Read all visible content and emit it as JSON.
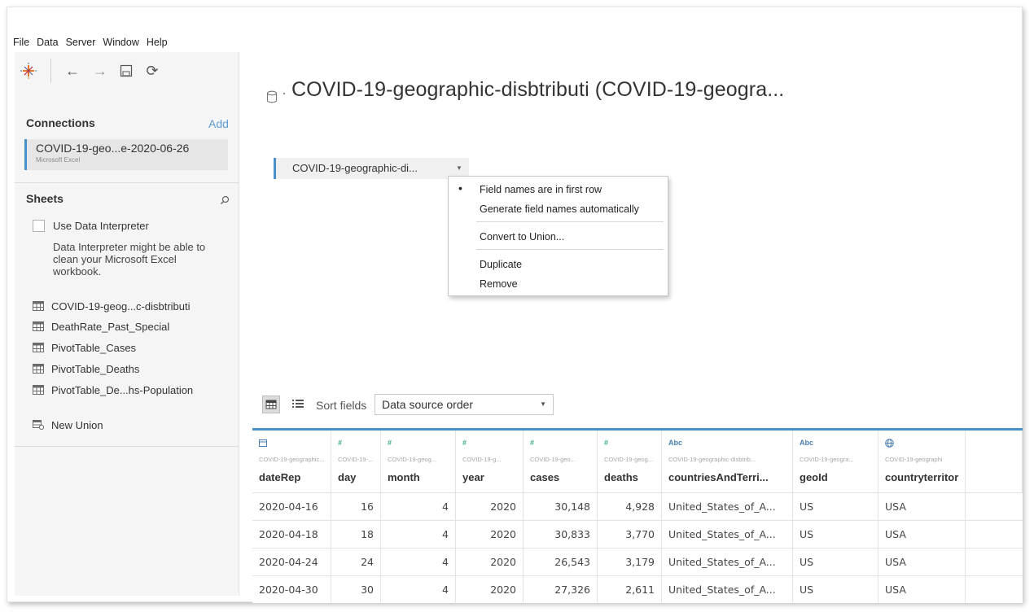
{
  "menu": [
    "File",
    "Data",
    "Server",
    "Window",
    "Help"
  ],
  "toolbar": {
    "icons": [
      "tableau-logo-icon",
      "back-arrow-icon",
      "forward-arrow-icon",
      "save-icon",
      "refresh-icon"
    ],
    "back": "←",
    "forward": "→",
    "refresh": "⟳"
  },
  "connections": {
    "title": "Connections",
    "add": "Add",
    "item": {
      "name": "COVID-19-geo...e-2020-06-26",
      "type": "Microsoft Excel"
    }
  },
  "sheets": {
    "title": "Sheets",
    "use_interpreter": "Use Data Interpreter",
    "interpreter_desc": "Data Interpreter might be able to clean your Microsoft Excel workbook.",
    "items": [
      "COVID-19-geog...c-disbtributi",
      "DeathRate_Past_Special",
      "PivotTable_Cases",
      "PivotTable_Deaths",
      "PivotTable_De...hs-Population"
    ],
    "new_union": "New Union"
  },
  "datasource": {
    "title": "COVID-19-geographic-disbtributi (COVID-19-geogra...",
    "dot": "·"
  },
  "table_pill": {
    "label": "COVID-19-geographic-di...",
    "arrow": "▼"
  },
  "context_menu": {
    "bullet": "•",
    "items": [
      "Field names are in first row",
      "Generate field names automatically",
      "Convert to Union...",
      "Duplicate",
      "Remove"
    ],
    "checked_index": 0
  },
  "grid_toolbar": {
    "sort_label": "Sort fields",
    "sort_value": "Data source order",
    "caret": "▼"
  },
  "columns": [
    {
      "type_icon": "calendar-icon",
      "type_label": "",
      "source": "COVID-19-geographic...",
      "name": "dateRep",
      "align": "txt"
    },
    {
      "type_icon": "number-icon",
      "type_label": "#",
      "source": "COVID-19-...",
      "name": "day",
      "align": "num"
    },
    {
      "type_icon": "number-icon",
      "type_label": "#",
      "source": "COVID-19-geog...",
      "name": "month",
      "align": "num"
    },
    {
      "type_icon": "number-icon",
      "type_label": "#",
      "source": "COVID-19-g...",
      "name": "year",
      "align": "num"
    },
    {
      "type_icon": "number-icon",
      "type_label": "#",
      "source": "COVID-19-geo...",
      "name": "cases",
      "align": "num"
    },
    {
      "type_icon": "number-icon",
      "type_label": "#",
      "source": "COVID-19-geog...",
      "name": "deaths",
      "align": "num"
    },
    {
      "type_icon": "string-icon",
      "type_label": "Abc",
      "source": "COVID-19-geographic-disbtrib...",
      "name": "countriesAndTerri...",
      "align": "txt"
    },
    {
      "type_icon": "string-icon",
      "type_label": "Abc",
      "source": "COVID-19-geogra...",
      "name": "geoId",
      "align": "txt"
    },
    {
      "type_icon": "globe-icon",
      "type_label": "",
      "source": "COVID-19-geographi",
      "name": "countryterritor",
      "align": "txt"
    }
  ],
  "rows": [
    [
      "2020-04-16",
      "16",
      "4",
      "2020",
      "30,148",
      "4,928",
      "United_States_of_A...",
      "US",
      "USA"
    ],
    [
      "2020-04-18",
      "18",
      "4",
      "2020",
      "30,833",
      "3,770",
      "United_States_of_A...",
      "US",
      "USA"
    ],
    [
      "2020-04-24",
      "24",
      "4",
      "2020",
      "26,543",
      "3,179",
      "United_States_of_A...",
      "US",
      "USA"
    ],
    [
      "2020-04-30",
      "30",
      "4",
      "2020",
      "27,326",
      "2,611",
      "United_States_of_A...",
      "US",
      "USA"
    ]
  ],
  "colors": {
    "accent": "#4a90c8",
    "number_type": "#3fae85",
    "string_type": "#4a7fb5",
    "date_type": "#4a7fb5"
  }
}
